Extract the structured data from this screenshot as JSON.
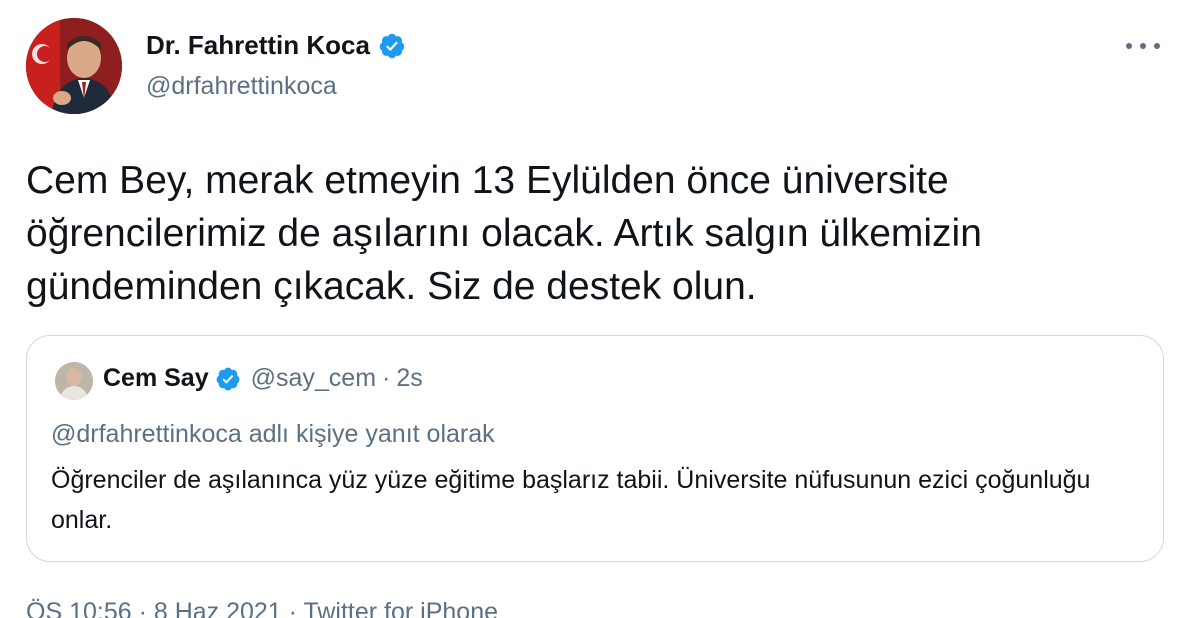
{
  "author": {
    "name": "Dr. Fahrettin Koca",
    "handle": "@drfahrettinkoca",
    "avatar_icon": "portrait-photo",
    "verified_icon": "verified-badge-icon"
  },
  "more_icon": "more-horizontal-icon",
  "tweet": {
    "text": "Cem Bey, merak etmeyin 13 Eylülden önce üniversite öğrencilerimiz de aşılarını olacak. Artık salgın ülkemizin gündeminden çıkacak. Siz de destek olun."
  },
  "quoted": {
    "name": "Cem Say",
    "handle": "@say_cem",
    "separator": "·",
    "time": "2s",
    "reply_to": "@drfahrettinkoca adlı kişiye yanıt olarak",
    "text": "Öğrenciler de aşılanınca yüz yüze eğitime başlarız tabii. Üniversite nüfusunun ezici çoğunluğu onlar."
  },
  "meta": {
    "line": "ÖS 10:56 · 8 Haz 2021 · Twitter for iPhone"
  },
  "colors": {
    "verified": "#1d9bf0",
    "muted": "#5b7083",
    "border": "#cfd9de"
  }
}
